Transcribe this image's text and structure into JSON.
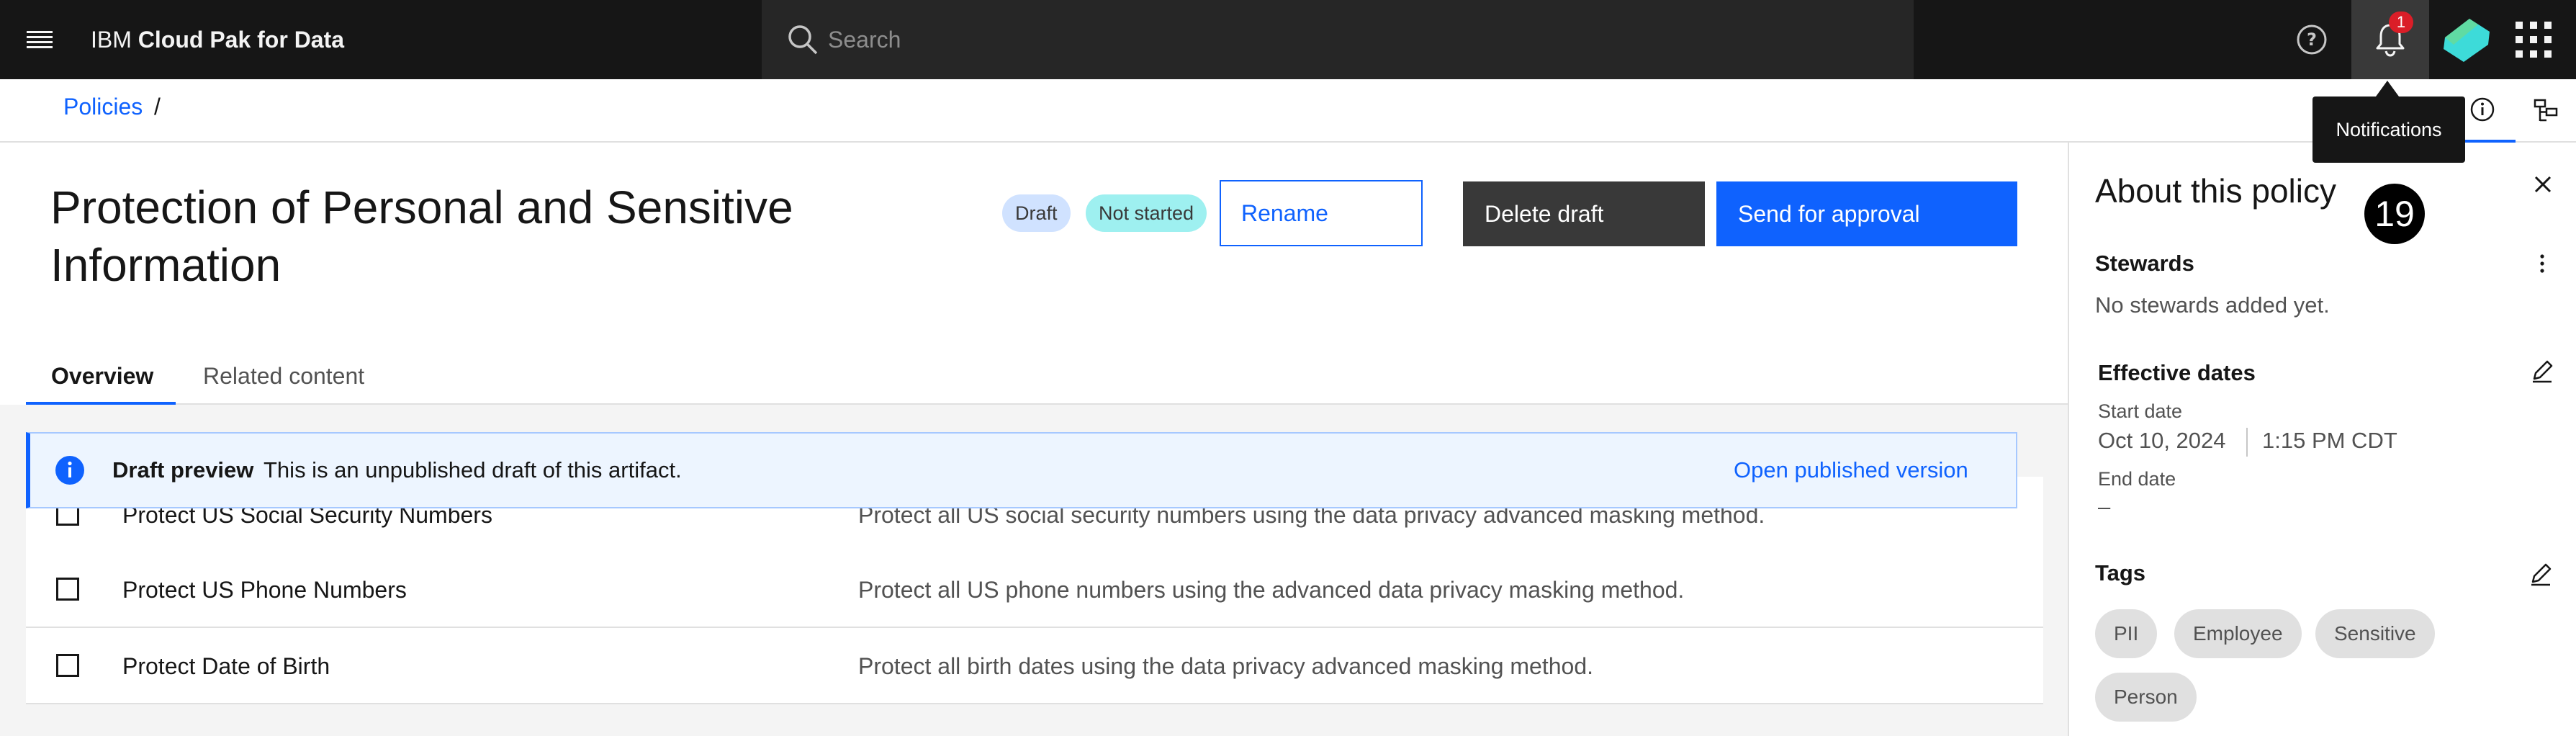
{
  "header": {
    "brand_prefix": "IBM",
    "brand_product": "Cloud Pak for Data",
    "search_placeholder": "Search",
    "notification_count": "1",
    "notifications_tooltip": "Notifications",
    "icons": [
      "menu-icon",
      "search-icon",
      "help-icon",
      "notification-icon",
      "avatar",
      "app-switcher-icon"
    ]
  },
  "breadcrumb": {
    "items": [
      "Policies"
    ],
    "separator": "/"
  },
  "page": {
    "title": "Protection of Personal and Sensitive Information",
    "tag_draft": "Draft",
    "tag_status": "Not started",
    "rename_label": "Rename",
    "delete_label": "Delete draft",
    "approve_label": "Send for approval"
  },
  "tabs": [
    {
      "label": "Overview",
      "selected": true
    },
    {
      "label": "Related content",
      "selected": false
    }
  ],
  "notice": {
    "title": "Draft preview",
    "text": "This is an unpublished draft of this artifact.",
    "link": "Open published version"
  },
  "rules": [
    {
      "name": "Protect US Social Security Numbers",
      "description": "Protect all US social security numbers using the data privacy advanced masking method."
    },
    {
      "name": "Protect US Phone Numbers",
      "description": "Protect all US phone numbers using the advanced data privacy masking method."
    },
    {
      "name": "Protect Date of Birth",
      "description": "Protect all birth dates using the data privacy advanced masking method."
    }
  ],
  "panel": {
    "title": "About this policy",
    "step_number": "19",
    "stewards_title": "Stewards",
    "stewards_empty": "No stewards added yet.",
    "dates_title": "Effective dates",
    "start_label": "Start date",
    "start_date": "Oct 10, 2024",
    "start_time": "1:15 PM CDT",
    "end_label": "End date",
    "end_date": "–",
    "tags_title": "Tags",
    "tags": [
      "PII",
      "Employee",
      "Sensitive",
      "Person"
    ]
  },
  "colors": {
    "accent": "#0f62fe",
    "header_bg": "#161616",
    "draft_tag": "#d0e2ff",
    "status_tag": "#9ef0f0",
    "badge": "#da1e28"
  }
}
